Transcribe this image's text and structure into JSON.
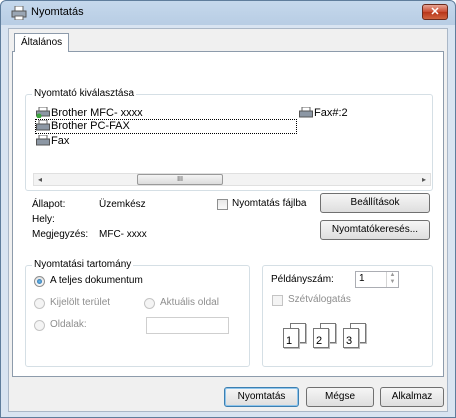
{
  "window": {
    "title": "Nyomtatás",
    "close_label": "✕"
  },
  "tabs": [
    {
      "label": "Általános"
    }
  ],
  "printer_select": {
    "title": "Nyomtató kiválasztása",
    "printers": [
      {
        "name": "Brother MFC- xxxx",
        "icon": "printer-icon"
      },
      {
        "name": "Brother PC-FAX",
        "icon": "fax-icon"
      },
      {
        "name": "Fax",
        "icon": "fax-icon"
      },
      {
        "name": "Fax#:2",
        "icon": "fax-icon"
      }
    ],
    "selected": "Brother PC-FAX",
    "scroll_left": "◂",
    "scroll_right": "▸",
    "scroll_thumb_grip": "III"
  },
  "status": {
    "status_label": "Állapot:",
    "status_value": "Üzemkész",
    "location_label": "Hely:",
    "location_value": "",
    "comment_label": "Megjegyzés:",
    "comment_value": "MFC- xxxx"
  },
  "print_to_file": {
    "label": "Nyomtatás fájlba",
    "checked": false
  },
  "buttons": {
    "preferences": "Beállítások",
    "find_printer": "Nyomtatókeresés...",
    "print": "Nyomtatás",
    "cancel": "Mégse",
    "apply": "Alkalmaz"
  },
  "page_range": {
    "title": "Nyomtatási tartomány",
    "options": {
      "all": "A teljes dokumentum",
      "selection": "Kijelölt terület",
      "current": "Aktuális oldal",
      "pages": "Oldalak:"
    },
    "selected": "all",
    "pages_value": ""
  },
  "copies": {
    "label": "Példányszám:",
    "value": "1",
    "collate_label": "Szétválogatás",
    "collate_checked": false,
    "collate_pages": [
      "1",
      "1",
      "2",
      "2",
      "3",
      "3"
    ]
  },
  "colors": {
    "accent": "#3c7fb1",
    "close": "#c94a2f",
    "frame": "#b8cde4"
  }
}
